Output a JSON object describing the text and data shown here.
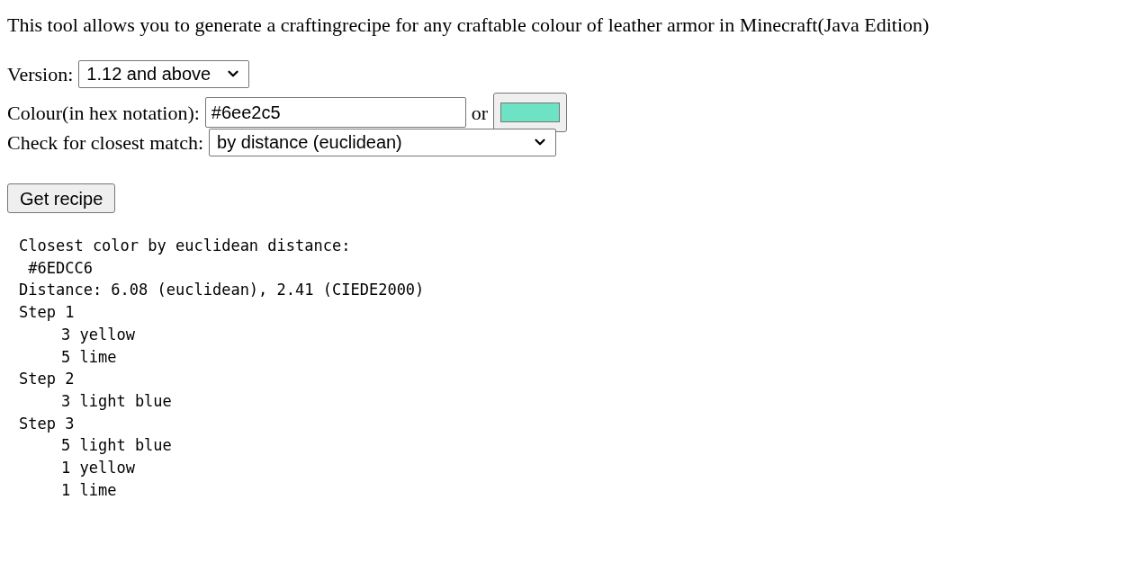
{
  "intro": "This tool allows you to generate a craftingrecipe for any craftable colour of leather armor in Minecraft(Java Edition)",
  "version": {
    "label": "Version:",
    "value": "1.12 and above"
  },
  "colour": {
    "label": "Colour(in hex notation):",
    "value": "#6ee2c5",
    "or": "or",
    "swatch": {
      "color": "#6ee2c5"
    }
  },
  "match": {
    "label": "Check for closest match:",
    "value": "by distance (euclidean)"
  },
  "button": "Get recipe",
  "result": {
    "heading": "Closest color by euclidean distance:",
    "hex": " #6EDCC6",
    "distance": "Distance: 6.08 (euclidean), 2.41 (CIEDE2000)",
    "steps": [
      {
        "label": "Step 1",
        "children": [
          "3 yellow",
          "5 lime"
        ]
      },
      {
        "label": "Step 2",
        "children": [
          "3 light blue"
        ]
      },
      {
        "label": "Step 3",
        "children": [
          "5 light blue",
          "1 yellow",
          "1 lime"
        ]
      }
    ]
  }
}
